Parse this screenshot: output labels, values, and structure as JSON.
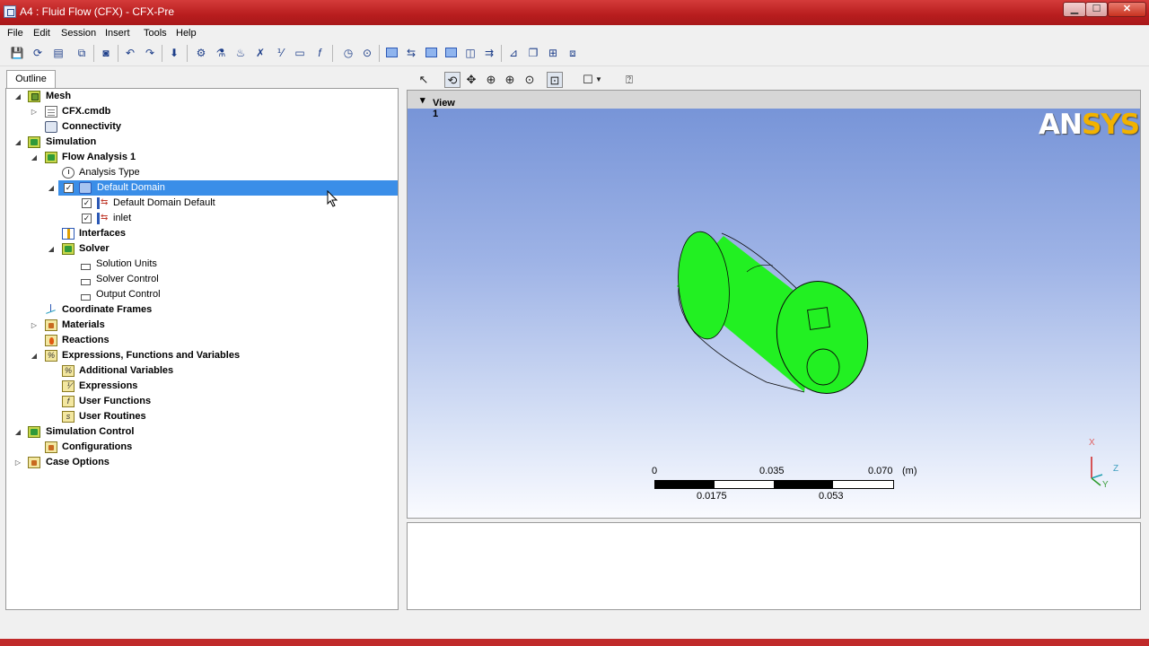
{
  "window": {
    "title": "A4 : Fluid Flow (CFX) - CFX-Pre",
    "minimize": "▁",
    "maximize": "☐",
    "close": "✕"
  },
  "menu": [
    "File",
    "Edit",
    "Session",
    "Insert",
    "Tools",
    "Help"
  ],
  "outline": {
    "tab_label": "Outline",
    "tree": [
      {
        "label": "Mesh",
        "bold": true
      },
      {
        "label": "CFX.cmdb",
        "bold": true
      },
      {
        "label": "Connectivity",
        "bold": true
      },
      {
        "label": "Simulation",
        "bold": true
      },
      {
        "label": "Flow Analysis 1",
        "bold": true
      },
      {
        "label": "Analysis Type",
        "bold": false
      },
      {
        "label": "Default Domain",
        "bold": false,
        "selected": true,
        "checked": true
      },
      {
        "label": "Default Domain Default",
        "bold": false,
        "checked": true
      },
      {
        "label": "inlet",
        "bold": false,
        "checked": true
      },
      {
        "label": "Interfaces",
        "bold": true
      },
      {
        "label": "Solver",
        "bold": true
      },
      {
        "label": "Solution Units",
        "bold": false
      },
      {
        "label": "Solver Control",
        "bold": false
      },
      {
        "label": "Output Control",
        "bold": false
      },
      {
        "label": "Coordinate Frames",
        "bold": true
      },
      {
        "label": "Materials",
        "bold": true
      },
      {
        "label": "Reactions",
        "bold": true
      },
      {
        "label": "Expressions, Functions and Variables",
        "bold": true
      },
      {
        "label": "Additional Variables",
        "bold": true
      },
      {
        "label": "Expressions",
        "bold": true
      },
      {
        "label": "User Functions",
        "bold": true
      },
      {
        "label": "User Routines",
        "bold": true
      },
      {
        "label": "Simulation Control",
        "bold": true
      },
      {
        "label": "Configurations",
        "bold": true
      },
      {
        "label": "Case Options",
        "bold": true
      }
    ]
  },
  "viewer": {
    "view_name": "View 1",
    "logo_main": "AN",
    "logo_accent": "SYS",
    "scale": {
      "top_labels": [
        "0",
        "0.035",
        "0.070"
      ],
      "unit": "(m)",
      "bottom_labels": [
        "0.0175",
        "0.053"
      ]
    },
    "triad": {
      "x": "X",
      "y": "Y",
      "z": "Z"
    }
  },
  "colors": {
    "selection": "#3a8ee8",
    "mesh_green": "#22f022",
    "titlebar": "#c02a2a",
    "viewport_top": "#7391d6",
    "viewport_bottom": "#fafbff"
  }
}
